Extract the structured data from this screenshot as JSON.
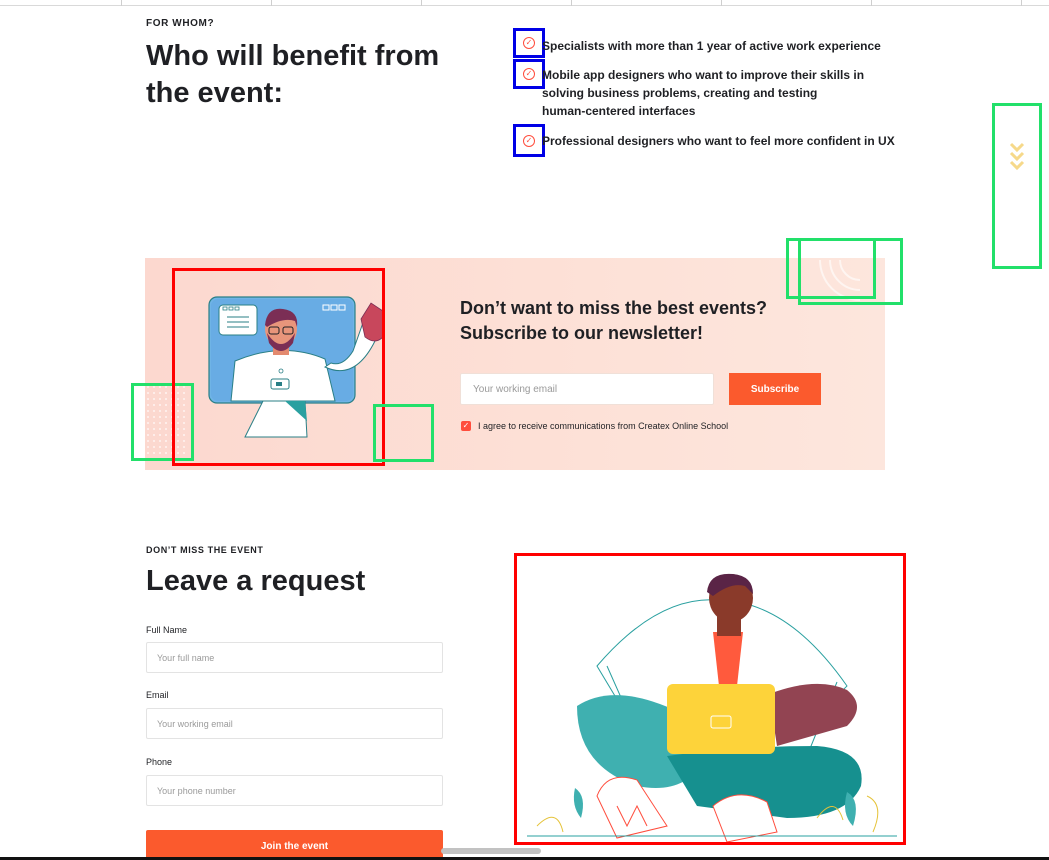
{
  "who": {
    "eyebrow": "FOR WHOM?",
    "title_line1": "Who will benefit from",
    "title_line2": "the event:",
    "items": [
      {
        "lines": [
          "Specialists with more than 1 year of active work experience"
        ],
        "icon": "check-circle-icon"
      },
      {
        "lines": [
          "Mobile app designers who want to improve their skills in",
          "solving business problems, creating and testing",
          "human-centered interfaces"
        ],
        "icon": "check-circle-icon"
      },
      {
        "lines": [
          "Professional designers who want to feel more confident in UX"
        ],
        "icon": "check-circle-icon"
      }
    ]
  },
  "scroll_indicator": {
    "icon": "double-chevron-down-icon"
  },
  "newsletter": {
    "title_line1": "Don’t want to miss the best events?",
    "title_line2": "Subscribe to our newsletter!",
    "email_placeholder": "Your working email",
    "subscribe_label": "Subscribe",
    "agree_text": "I agree to receive communications from Createx Online School",
    "agree_checked": true
  },
  "request": {
    "eyebrow": "DON’T MISS THE EVENT",
    "title": "Leave a request",
    "full_name_label": "Full Name",
    "full_name_placeholder": "Your full name",
    "email_label": "Email",
    "email_placeholder": "Your working email",
    "phone_label": "Phone",
    "phone_placeholder": "Your phone number",
    "join_label": "Join the event"
  },
  "colors": {
    "accent": "#fb5a2d",
    "check": "#ff4d3d",
    "annotation_blue": "#0000e6",
    "annotation_green": "#22e06a",
    "annotation_red": "#ff0000"
  }
}
